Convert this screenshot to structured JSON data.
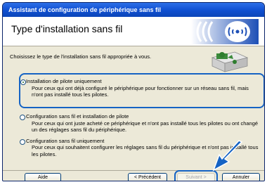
{
  "window": {
    "title": "Assistant de configuration de périphérique sans fil"
  },
  "header": {
    "title": "Type d'installation sans fil"
  },
  "intro": "Choisissez le type de l'installation sans fil appropriée à vous.",
  "options": [
    {
      "title": "Installation de pilote uniquement",
      "desc": "Pour ceux qui ont déjà configuré le périphérique pour fonctionner sur un réseau sans fil, mais n'ont pas installé tous les pilotes.",
      "selected": true
    },
    {
      "title": "Configuration sans fil et installation de pilote",
      "desc": "Pour ceux qui ont juste acheté ce périphérique et n'ont pas installé tous les pilotes ou ont changé un des réglages sans fil du périphérique.",
      "selected": false
    },
    {
      "title": "Configuration sans fil uniquement",
      "desc": "Pour ceux qui souhaitent configurer les réglages sans fil du périphérique et n'ont pas installé tous les pilotes.",
      "selected": false
    }
  ],
  "buttons": {
    "help": "Aide",
    "back": "< Précédent",
    "next": "Suivant >",
    "cancel": "Annuler"
  },
  "colors": {
    "title_bar": "#0f4fd0",
    "highlight": "#1563c4",
    "window_bg": "#ece9d8"
  }
}
